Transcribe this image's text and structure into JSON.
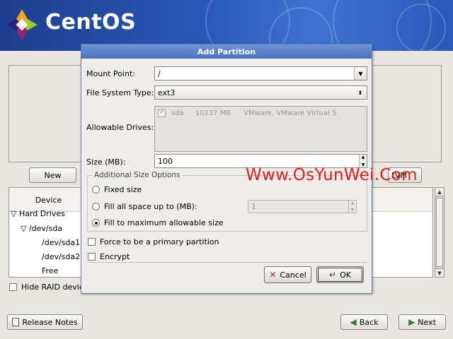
{
  "brand": {
    "name": "CentOS"
  },
  "dialog": {
    "title": "Add Partition",
    "mount_point_label": "Mount Point:",
    "mount_point_value": "/",
    "fs_type_label": "File System Type:",
    "fs_type_value": "ext3",
    "allowable_drives_label": "Allowable Drives:",
    "drives": [
      {
        "name": "sda",
        "size": "10237 MB",
        "model": "VMware, VMware Virtual S"
      }
    ],
    "size_label": "Size (MB):",
    "size_value": "100",
    "additional_size_options": "Additional Size Options",
    "fixed_size": "Fixed size",
    "fill_upto": "Fill all space up to (MB):",
    "fill_upto_value": "1",
    "fill_max": "Fill to maximum allowable size",
    "force_primary": "Force to be a primary partition",
    "encrypt": "Encrypt",
    "cancel": "Cancel",
    "ok": "OK"
  },
  "main": {
    "new_button": "New",
    "lvm_button": "LVM",
    "tree": {
      "column_device": "Device",
      "rows": [
        "Hard Drives",
        "/dev/sda",
        "/dev/sda1",
        "/dev/sda2",
        "Free"
      ]
    },
    "hide_raid": "Hide RAID device/LVM Volume Group members"
  },
  "footer": {
    "release_notes": "Release Notes",
    "back": "Back",
    "next": "Next"
  },
  "watermark": "Www.OsYunWei.Com",
  "colors": {
    "banner": "#2b58b8",
    "title_bar": "#5a80c8",
    "watermark": "#e31c1c"
  }
}
